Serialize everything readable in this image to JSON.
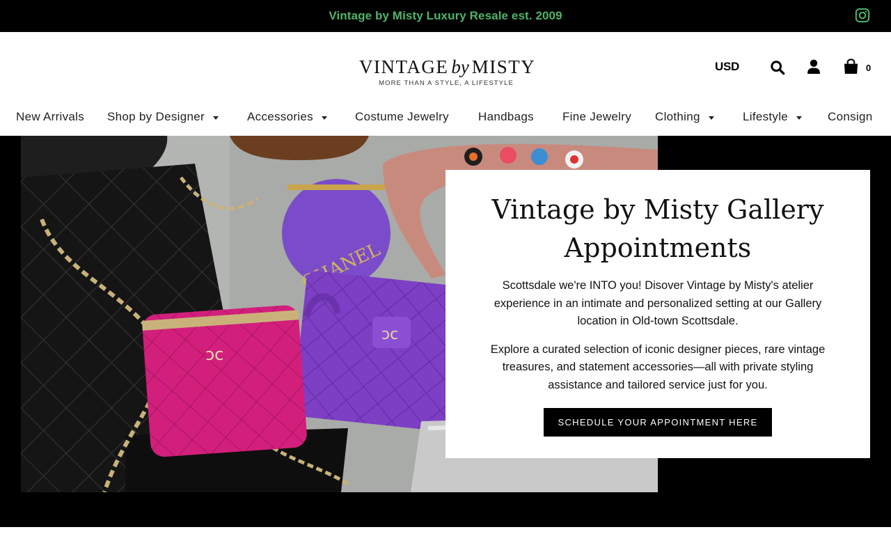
{
  "announcement": {
    "text": "Vintage by Misty Luxury Resale est. 2009",
    "icon": "instagram-icon",
    "color": "#4fb36a"
  },
  "header": {
    "logo": {
      "word1": "VINTAGE",
      "by": "by",
      "word2": "MISTY",
      "tagline": "MORE THAN A STYLE, A LIFESTYLE"
    },
    "currency": "USD",
    "icons": [
      "search-icon",
      "account-icon",
      "cart-icon"
    ],
    "cart_count": "0"
  },
  "nav": {
    "items": [
      {
        "label": "New Arrivals",
        "dropdown": false
      },
      {
        "label": "Shop by Designer",
        "dropdown": true
      },
      {
        "label": "Accessories",
        "dropdown": true
      },
      {
        "label": "Costume Jewelry",
        "dropdown": false
      },
      {
        "label": "Handbags",
        "dropdown": false
      },
      {
        "label": "Fine Jewelry",
        "dropdown": false
      },
      {
        "label": "Clothing",
        "dropdown": true
      },
      {
        "label": "Lifestyle",
        "dropdown": true
      },
      {
        "label": "Consign",
        "dropdown": false
      }
    ]
  },
  "hero": {
    "image_text": "CHANEL",
    "title_line1": "Vintage by Misty Gallery",
    "title_line2": "Appointments",
    "paragraph1": "Scottsdale we're INTO you! Disover Vintage by Misty's atelier experience in an intimate and personalized setting at our Gallery location in Old-town Scottsdale.",
    "paragraph2": "Explore a curated selection of iconic designer pieces, rare vintage treasures, and statement accessories—all with private styling assistance and tailored service just for you.",
    "cta_label": "SCHEDULE YOUR APPOINTMENT HERE"
  },
  "colors": {
    "accent": "#4fb36a",
    "background": "#000000",
    "panel": "#ffffff"
  }
}
